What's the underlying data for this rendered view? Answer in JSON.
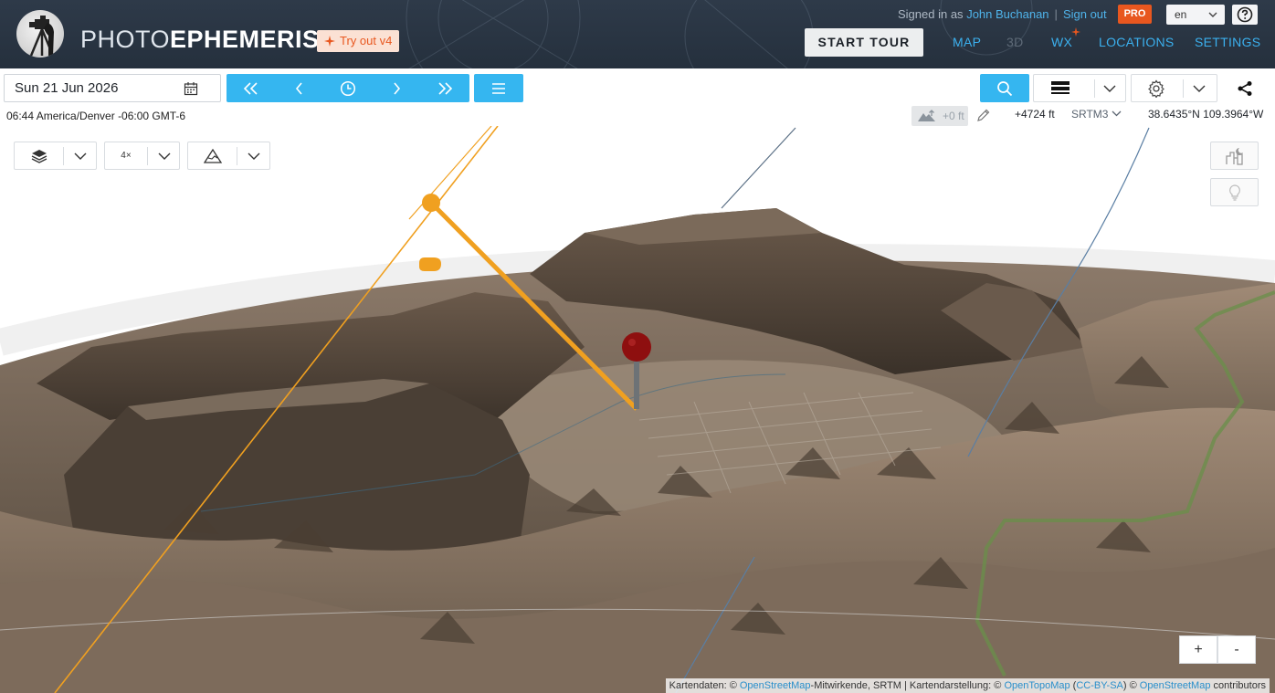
{
  "header": {
    "logo_light": "PHOTO",
    "logo_bold": "EPHEMERIS",
    "tryout_label": "Try out v4",
    "signed_in_prefix": "Signed in as",
    "user_name": "John Buchanan",
    "separator": "|",
    "sign_out": "Sign out",
    "pro_badge": "PRO",
    "language": "en",
    "start_tour": "START TOUR",
    "nav": {
      "map": "MAP",
      "three_d": "3D",
      "wx": "WX",
      "locations": "LOCATIONS",
      "settings": "SETTINGS"
    }
  },
  "toolbar": {
    "date": "Sun 21 Jun 2026",
    "timezone": "06:44 America/Denver -06:00 GMT-6",
    "elevation_offset": "+0 ft",
    "altitude": "+4724 ft",
    "dem_source": "SRTM3",
    "coordinates": "38.6435°N 109.3964°W"
  },
  "map_controls": {
    "resolution": "4×",
    "zoom_in": "+",
    "zoom_out": "-"
  },
  "attribution": {
    "prefix": "Kartendaten: ©",
    "osm": "OpenStreetMap",
    "mid": "-Mitwirkende, SRTM | Kartendarstellung: ©",
    "otm": "OpenTopoMap",
    "paren_open": "(",
    "license": "CC-BY-SA",
    "paren_close": ") ©",
    "osm2": "OpenStreetMap",
    "suffix": "contributors"
  },
  "colors": {
    "accent_blue": "#35b6f0",
    "brand_orange": "#e8571f",
    "sun_line": "#f0a020",
    "pin": "#8e0f0f"
  }
}
